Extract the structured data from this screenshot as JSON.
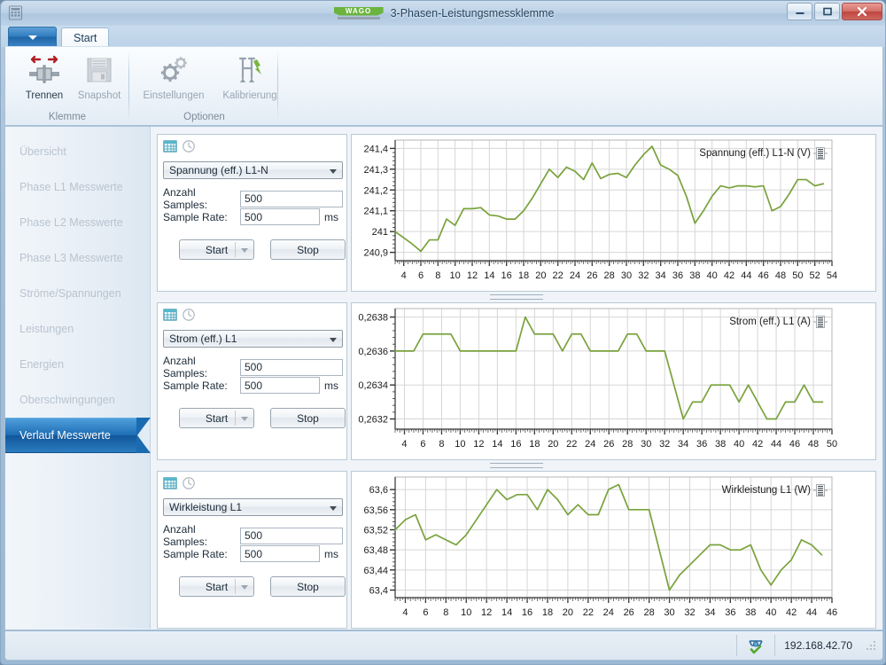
{
  "window": {
    "title": "3-Phasen-Leistungsmessklemme",
    "logo_text": "WAGO",
    "app_icon_name": "app-icon",
    "buttons": {
      "minimize": "–",
      "maximize": "▭",
      "close": "✕"
    }
  },
  "ribbon": {
    "app_menu_label": "",
    "tabs": [
      {
        "label": "Start",
        "active": true
      }
    ],
    "groups": [
      {
        "name": "Klemme",
        "items": [
          {
            "label": "Trennen",
            "icon": "disconnect-icon",
            "disabled": false
          },
          {
            "label": "Snapshot",
            "icon": "floppy-disk-icon",
            "disabled": true
          }
        ]
      },
      {
        "name": "Optionen",
        "items": [
          {
            "label": "Einstellungen",
            "icon": "gear-icon",
            "disabled": true
          },
          {
            "label": "Kalibrierung",
            "icon": "caliper-icon",
            "disabled": true
          }
        ]
      }
    ]
  },
  "sidebar": {
    "items": [
      {
        "label": "Übersicht",
        "active": false
      },
      {
        "label": "Phase L1 Messwerte",
        "active": false
      },
      {
        "label": "Phase L2 Messwerte",
        "active": false
      },
      {
        "label": "Phase L3 Messwerte",
        "active": false
      },
      {
        "label": "Ströme/Spannungen",
        "active": false
      },
      {
        "label": "Leistungen",
        "active": false
      },
      {
        "label": "Energien",
        "active": false
      },
      {
        "label": "Oberschwingungen",
        "active": false
      },
      {
        "label": "Verlauf Messwerte",
        "active": true
      }
    ]
  },
  "panels": [
    {
      "table_icon": "table-grid-icon",
      "clock_icon": "clock-icon",
      "selected_channel": "Spannung (eff.) L1-N",
      "samples_label": "Anzahl Samples:",
      "samples_value": "500",
      "rate_label": "Sample Rate:",
      "rate_value": "500",
      "rate_unit": "ms",
      "start_label": "Start",
      "stop_label": "Stop"
    },
    {
      "table_icon": "table-grid-icon",
      "clock_icon": "clock-icon",
      "selected_channel": "Strom (eff.) L1",
      "samples_label": "Anzahl Samples:",
      "samples_value": "500",
      "rate_label": "Sample Rate:",
      "rate_value": "500",
      "rate_unit": "ms",
      "start_label": "Start",
      "stop_label": "Stop"
    },
    {
      "table_icon": "table-grid-icon",
      "clock_icon": "clock-icon",
      "selected_channel": "Wirkleistung L1",
      "samples_label": "Anzahl Samples:",
      "samples_value": "500",
      "rate_label": "Sample Rate:",
      "rate_value": "500",
      "rate_unit": "ms",
      "start_label": "Start",
      "stop_label": "Stop"
    }
  ],
  "statusbar": {
    "connection_icon": "network-connected-icon",
    "ip_address": "192.168.42.70"
  },
  "accent_colors": {
    "series_green": "#79a23c",
    "selection_blue": "#1e6fb5",
    "logo_green": "#6cb33f",
    "grid_gray": "#d6d6d6"
  },
  "chart_data": [
    {
      "type": "line",
      "title": "",
      "legend": [
        "Spannung (eff.) L1-N (V)"
      ],
      "legend_position": "top-right",
      "xlabel": "",
      "ylabel": "",
      "grid": true,
      "xlim": [
        3,
        54
      ],
      "ylim": [
        240.86,
        241.44
      ],
      "xticks": [
        4,
        6,
        8,
        10,
        12,
        14,
        16,
        18,
        20,
        22,
        24,
        26,
        28,
        30,
        32,
        34,
        36,
        38,
        40,
        42,
        44,
        46,
        48,
        50,
        52,
        54
      ],
      "yticks": [
        240.9,
        241,
        241.1,
        241.2,
        241.3,
        241.4
      ],
      "ytick_labels": [
        "240,9",
        "241",
        "241,1",
        "241,2",
        "241,3",
        "241,4"
      ],
      "x": [
        3,
        4,
        5,
        6,
        7,
        8,
        9,
        10,
        11,
        12,
        13,
        14,
        15,
        16,
        17,
        18,
        19,
        20,
        21,
        22,
        23,
        24,
        25,
        26,
        27,
        28,
        29,
        30,
        31,
        32,
        33,
        34,
        35,
        36,
        37,
        38,
        39,
        40,
        41,
        42,
        43,
        44,
        45,
        46,
        47,
        48,
        49,
        50,
        51,
        52,
        53
      ],
      "values": [
        241.0,
        240.97,
        240.94,
        240.905,
        240.96,
        240.96,
        241.06,
        241.03,
        241.11,
        241.11,
        241.115,
        241.08,
        241.075,
        241.06,
        241.06,
        241.1,
        241.16,
        241.23,
        241.3,
        241.26,
        241.31,
        241.29,
        241.25,
        241.33,
        241.255,
        241.275,
        241.28,
        241.26,
        241.32,
        241.37,
        241.41,
        241.32,
        241.3,
        241.27,
        241.17,
        241.04,
        241.1,
        241.17,
        241.22,
        241.21,
        241.22,
        241.22,
        241.215,
        241.22,
        241.1,
        241.12,
        241.18,
        241.25,
        241.25,
        241.22,
        241.23
      ]
    },
    {
      "type": "line",
      "title": "",
      "legend": [
        "Strom (eff.) L1 (A)"
      ],
      "legend_position": "top-right",
      "xlabel": "",
      "ylabel": "",
      "grid": true,
      "xlim": [
        3,
        50
      ],
      "ylim": [
        0.26314,
        0.26385
      ],
      "xticks": [
        4,
        6,
        8,
        10,
        12,
        14,
        16,
        18,
        20,
        22,
        24,
        26,
        28,
        30,
        32,
        34,
        36,
        38,
        40,
        42,
        44,
        46,
        48,
        50
      ],
      "yticks": [
        0.2632,
        0.2634,
        0.2636,
        0.2638
      ],
      "ytick_labels": [
        "0,2632",
        "0,2634",
        "0,2636",
        "0,2638"
      ],
      "x": [
        3,
        4,
        5,
        6,
        7,
        8,
        9,
        10,
        11,
        12,
        13,
        14,
        15,
        16,
        17,
        18,
        19,
        20,
        21,
        22,
        23,
        24,
        25,
        26,
        27,
        28,
        29,
        30,
        31,
        32,
        33,
        34,
        35,
        36,
        37,
        38,
        39,
        40,
        41,
        42,
        43,
        44,
        45,
        46,
        47,
        48,
        49
      ],
      "values": [
        0.2636,
        0.2636,
        0.2636,
        0.2637,
        0.2637,
        0.2637,
        0.2637,
        0.2636,
        0.2636,
        0.2636,
        0.2636,
        0.2636,
        0.2636,
        0.2636,
        0.2638,
        0.2637,
        0.2637,
        0.2637,
        0.2636,
        0.2637,
        0.2637,
        0.2636,
        0.2636,
        0.2636,
        0.2636,
        0.2637,
        0.2637,
        0.2636,
        0.2636,
        0.2636,
        0.2634,
        0.2632,
        0.2633,
        0.2633,
        0.2634,
        0.2634,
        0.2634,
        0.2633,
        0.2634,
        0.2633,
        0.2632,
        0.2632,
        0.2633,
        0.2633,
        0.2634,
        0.2633,
        0.2633
      ]
    },
    {
      "type": "line",
      "title": "",
      "legend": [
        "Wirkleistung L1 (W)"
      ],
      "legend_position": "top-right",
      "xlabel": "",
      "ylabel": "",
      "grid": true,
      "xlim": [
        3,
        46
      ],
      "ylim": [
        63.385,
        63.625
      ],
      "xticks": [
        4,
        6,
        8,
        10,
        12,
        14,
        16,
        18,
        20,
        22,
        24,
        26,
        28,
        30,
        32,
        34,
        36,
        38,
        40,
        42,
        44,
        46
      ],
      "yticks": [
        63.4,
        63.44,
        63.48,
        63.52,
        63.56,
        63.6
      ],
      "ytick_labels": [
        "63,4",
        "63,44",
        "63,48",
        "63,52",
        "63,56",
        "63,6"
      ],
      "x": [
        3,
        4,
        5,
        6,
        7,
        8,
        9,
        10,
        11,
        12,
        13,
        14,
        15,
        16,
        17,
        18,
        19,
        20,
        21,
        22,
        23,
        24,
        25,
        26,
        27,
        28,
        29,
        30,
        31,
        32,
        33,
        34,
        35,
        36,
        37,
        38,
        39,
        40,
        41,
        42,
        43,
        44,
        45
      ],
      "values": [
        63.52,
        63.54,
        63.55,
        63.5,
        63.51,
        63.5,
        63.49,
        63.51,
        63.54,
        63.57,
        63.6,
        63.58,
        63.59,
        63.59,
        63.56,
        63.6,
        63.58,
        63.55,
        63.57,
        63.55,
        63.55,
        63.6,
        63.61,
        63.56,
        63.56,
        63.56,
        63.48,
        63.4,
        63.43,
        63.45,
        63.47,
        63.49,
        63.49,
        63.48,
        63.48,
        63.49,
        63.44,
        63.41,
        63.44,
        63.46,
        63.5,
        63.49,
        63.47
      ]
    }
  ]
}
